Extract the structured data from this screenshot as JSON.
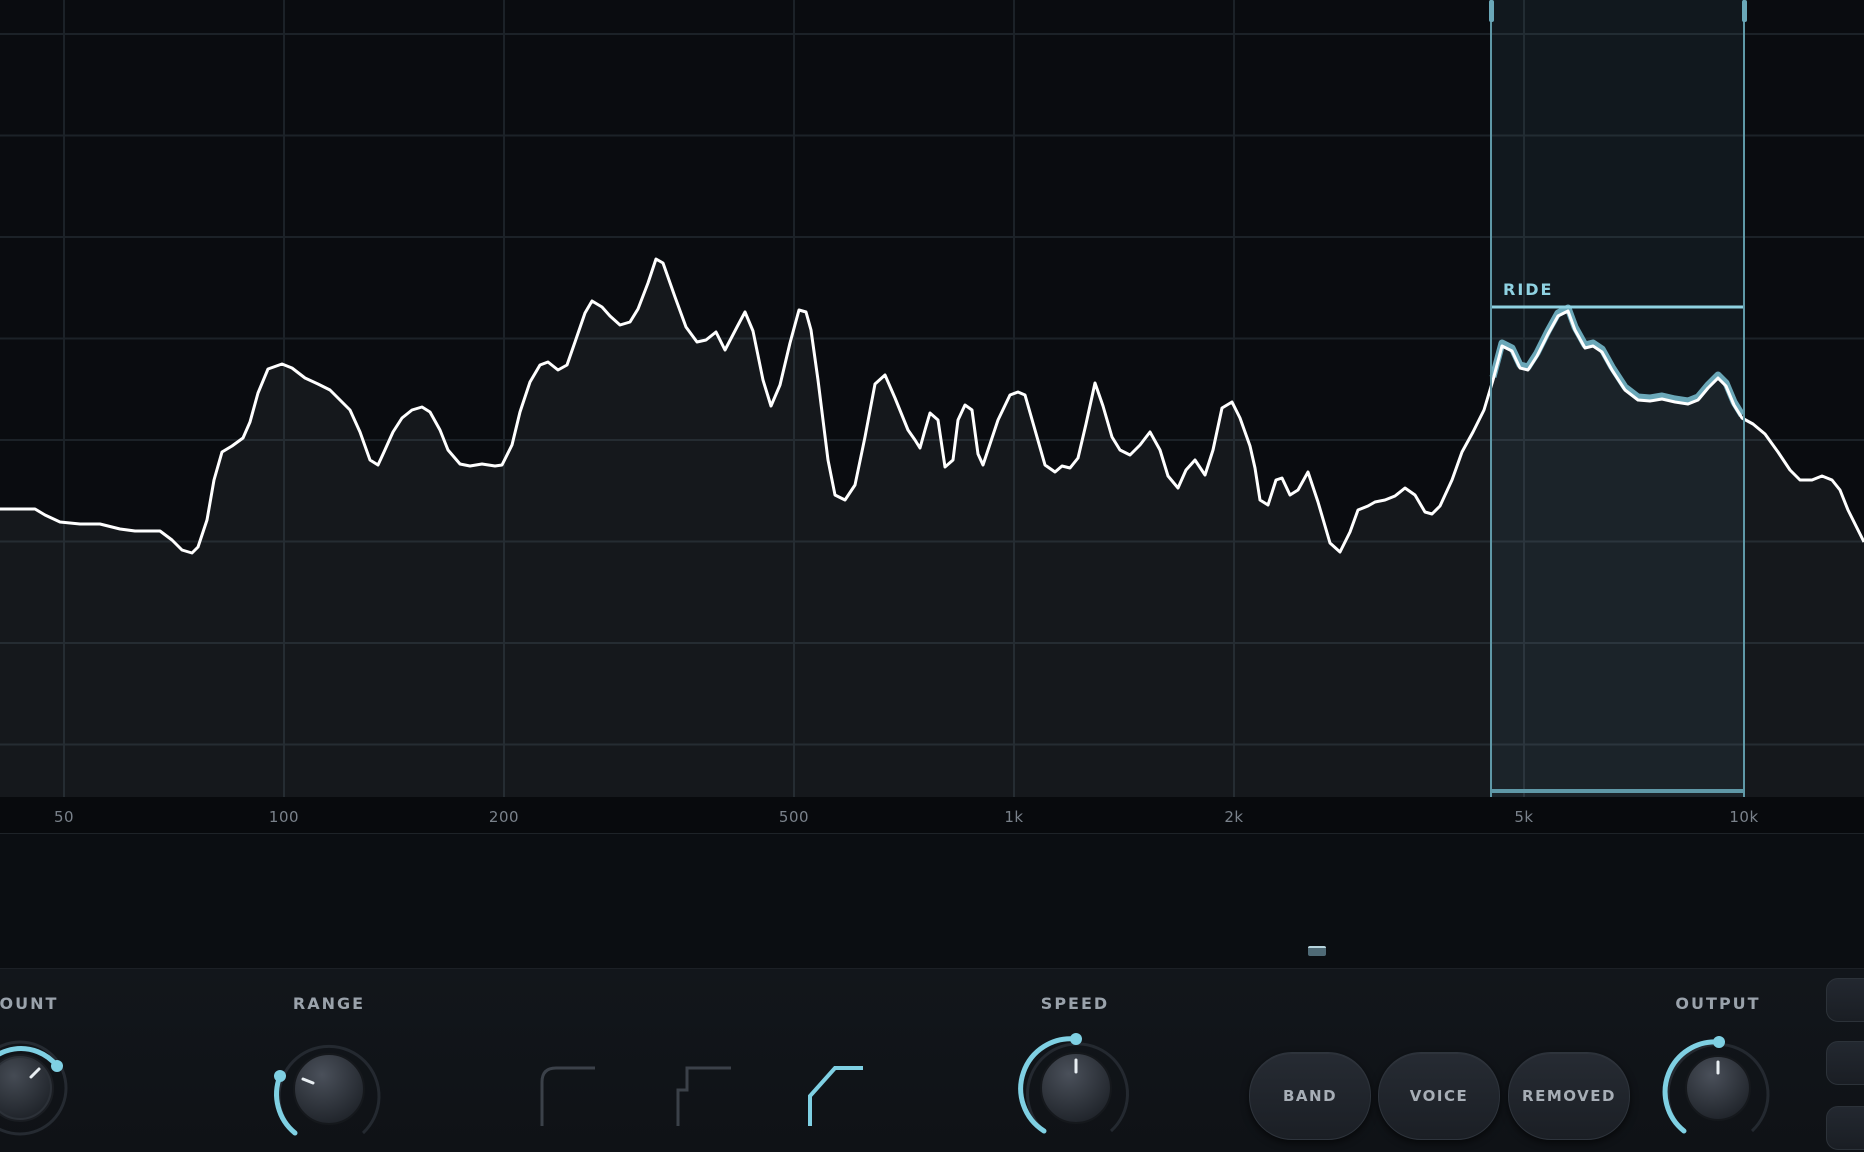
{
  "analyzer": {
    "frequency_labels": [
      "50",
      "100",
      "200",
      "500",
      "1k",
      "2k",
      "5k",
      "10k"
    ],
    "band": {
      "label": "RIDE",
      "start": "5k (approx.)",
      "end": "10k"
    },
    "accent_color": "#7fd0e3",
    "spectrum_color": "#ffffff"
  },
  "controls": {
    "amount_label": "MOUNT",
    "range_label": "RANGE",
    "speed_label": "SPEED",
    "output_label": "OUTPUT",
    "filter_modes": [
      "low-shelf-icon",
      "step-icon",
      "high-shelf-icon"
    ],
    "active_filter_mode": "high-shelf-icon",
    "buttons": [
      "BAND",
      "VOICE",
      "REMOVED"
    ]
  }
}
